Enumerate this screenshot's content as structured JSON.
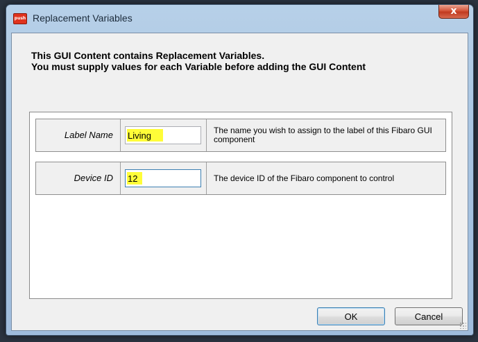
{
  "window": {
    "title": "Replacement Variables",
    "app_icon_text": "push",
    "close_glyph": "x"
  },
  "header": {
    "line1": "This GUI Content contains Replacement Variables.",
    "line2": "You must supply values for each Variable before adding the GUI Content"
  },
  "variables": [
    {
      "label": "Label Name",
      "value": "Living",
      "description": "The name you wish to assign to the label of this Fibaro GUI component"
    },
    {
      "label": "Device ID",
      "value": "12",
      "description": "The device ID of the Fibaro component to control"
    }
  ],
  "buttons": {
    "ok_label": "OK",
    "cancel_label": "Cancel"
  },
  "icons": {
    "app": "app-logo-icon",
    "close": "close-icon",
    "grip": "resize-grip-icon"
  },
  "colors": {
    "highlight": "#fffd38",
    "close_button": "#c03a20",
    "focus_border": "#3c7fb1"
  }
}
